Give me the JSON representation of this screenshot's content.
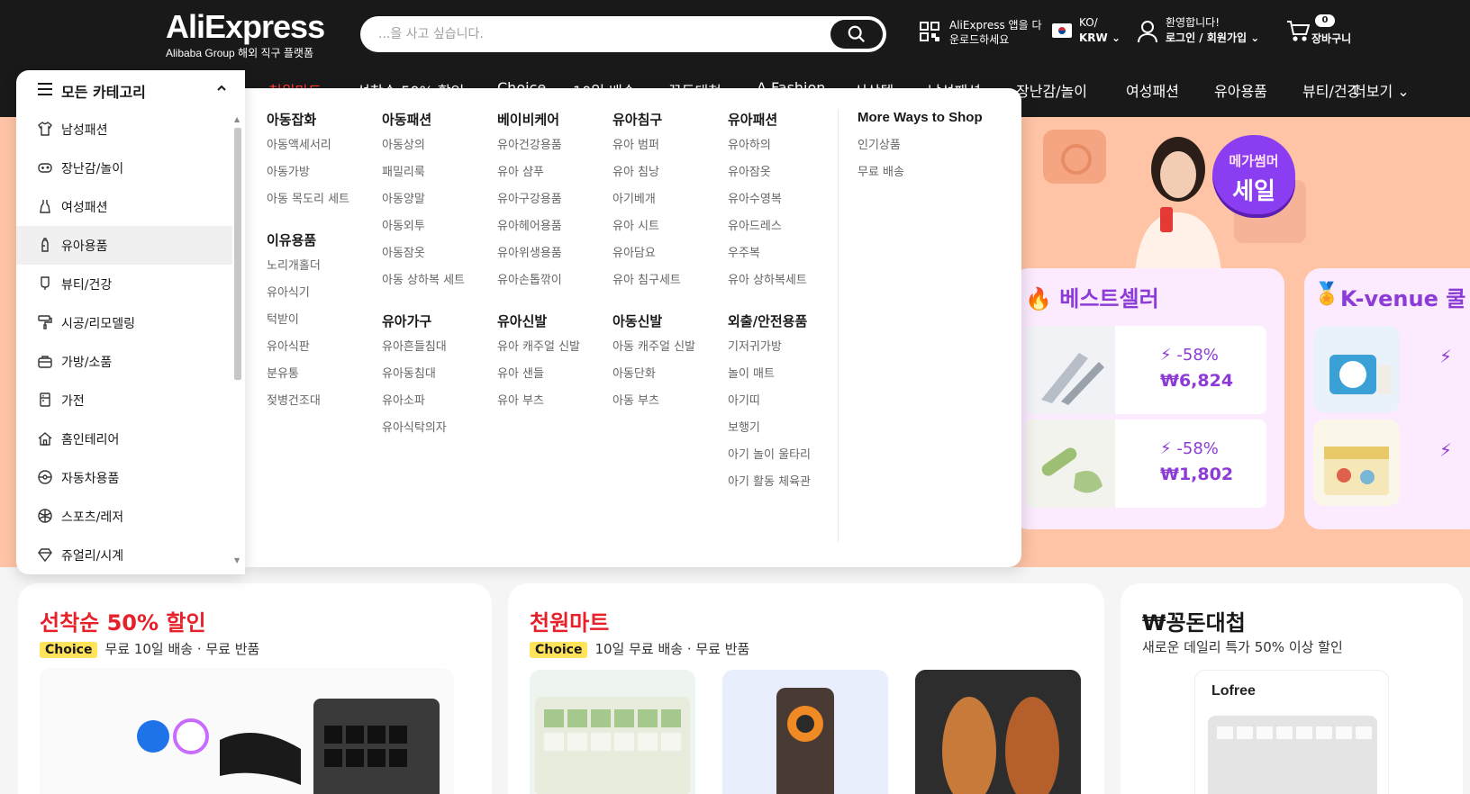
{
  "header": {
    "logo_main": "AliExpress",
    "logo_sub": "Alibaba Group 해외 직구 플랫폼",
    "search_placeholder": "...을 사고 싶습니다.",
    "app_line1": "AliExpress 앱을 다",
    "app_line2": "운로드하세요",
    "lang_line1": "KO/",
    "lang_line2": "KRW",
    "account_line1": "환영합니다!",
    "account_line2": "로그인 / 회원가입",
    "cart_count": "0",
    "cart_label": "장바구니"
  },
  "nav": {
    "items": [
      "천원마트",
      "선착순 50% 할인",
      "Choice",
      "10일 배송",
      "꽁돈대첩",
      "A Fashion",
      "신상템",
      "남성패션",
      "장난감/놀이",
      "여성패션",
      "유아용품",
      "뷰티/건강"
    ],
    "more": "더보기"
  },
  "categories": {
    "header": "모든 카테고리",
    "items": [
      {
        "label": "남성패션",
        "icon": "shirt-icon"
      },
      {
        "label": "장난감/놀이",
        "icon": "gamepad-icon"
      },
      {
        "label": "여성패션",
        "icon": "dress-icon"
      },
      {
        "label": "유아용품",
        "icon": "baby-bottle-icon"
      },
      {
        "label": "뷰티/건강",
        "icon": "beauty-icon"
      },
      {
        "label": "시공/리모델링",
        "icon": "paint-roller-icon"
      },
      {
        "label": "가방/소품",
        "icon": "bag-icon"
      },
      {
        "label": "가전",
        "icon": "appliance-icon"
      },
      {
        "label": "홈인테리어",
        "icon": "home-icon"
      },
      {
        "label": "자동차용품",
        "icon": "car-icon"
      },
      {
        "label": "스포츠/레저",
        "icon": "ball-icon"
      },
      {
        "label": "쥬얼리/시계",
        "icon": "jewel-icon"
      }
    ],
    "active_index": 3
  },
  "mega": {
    "columns": [
      {
        "groups": [
          {
            "title": "아동잡화",
            "items": [
              "아동액세서리",
              "아동가방",
              "아동 목도리 세트"
            ]
          },
          {
            "title": "이유용품",
            "items": [
              "노리개홀더",
              "유아식기",
              "턱받이",
              "유아식판",
              "분유통",
              "젖병건조대"
            ]
          }
        ]
      },
      {
        "groups": [
          {
            "title": "아동패션",
            "items": [
              "아동상의",
              "패밀리룩",
              "아동양말",
              "아동외투",
              "아동잠옷",
              "아동 상하복 세트"
            ]
          },
          {
            "title": "유아가구",
            "items": [
              "유아흔들침대",
              "유아동침대",
              "유아소파",
              "유아식탁의자"
            ]
          }
        ]
      },
      {
        "groups": [
          {
            "title": "베이비케어",
            "items": [
              "유아건강용품",
              "유아 샴푸",
              "유아구강용품",
              "유아헤어용품",
              "유아위생용품",
              "유아손톱깎이"
            ]
          },
          {
            "title": "유아신발",
            "items": [
              "유아 캐주얼 신발",
              "유아 샌들",
              "유아 부츠"
            ]
          }
        ]
      },
      {
        "groups": [
          {
            "title": "유아침구",
            "items": [
              "유아 범퍼",
              "유아 침낭",
              "아기베개",
              "유아 시트",
              "유아담요",
              "유아 침구세트"
            ]
          },
          {
            "title": "아동신발",
            "items": [
              "아동 캐주얼 신발",
              "아동단화",
              "아동 부츠"
            ]
          }
        ]
      },
      {
        "groups": [
          {
            "title": "유아패션",
            "items": [
              "유아하의",
              "유아잠옷",
              "유아수영복",
              "유아드레스",
              "우주복",
              "유아 상하복세트"
            ]
          },
          {
            "title": "외출/안전용품",
            "items": [
              "기저귀가방",
              "놀이 매트",
              "아기띠",
              "보행기",
              "아기 놀이 울타리",
              "아기 활동 체육관"
            ]
          }
        ]
      }
    ],
    "more_title": "More Ways to Shop",
    "more_items": [
      "인기상품",
      "무료 배송"
    ]
  },
  "banner": {
    "mega_line1": "메가썸머",
    "mega_line2": "세일",
    "best_title": "베스트셀러",
    "kvenue_title": "K-venue 쿨",
    "best_products": [
      {
        "discount": "-58%",
        "price": "₩6,824"
      },
      {
        "discount": "-58%",
        "price": "₩1,802"
      }
    ]
  },
  "cards": [
    {
      "title": "선착순 50% 할인",
      "choice": "Choice",
      "sub": "무료 10일 배송 · 무료 반품"
    },
    {
      "title": "천원마트",
      "choice": "Choice",
      "sub": "10일 무료 배송 · 무료 반품"
    },
    {
      "title": "₩꽁돈대첩",
      "sub": "새로운 데일리 특가 50% 이상 할인",
      "brand": "Lofree"
    }
  ],
  "colors": {
    "header_bg": "#191919",
    "accent_red": "#e8202a",
    "purple": "#8d3bd6",
    "banner_bg": "#ffc4a6"
  }
}
